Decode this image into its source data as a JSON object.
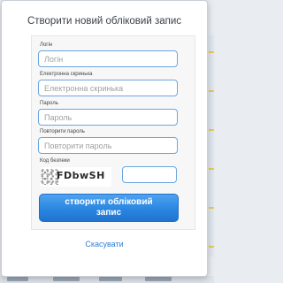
{
  "dialog": {
    "title": "Створити новий обліковий запис",
    "fields": {
      "login": {
        "label": "Логін",
        "placeholder": "Логін",
        "value": ""
      },
      "email": {
        "label": "Електронна скринька",
        "placeholder": "Електронна скринька",
        "value": ""
      },
      "password": {
        "label": "Пароль",
        "placeholder": "Пароль",
        "value": ""
      },
      "password_repeat": {
        "label": "Повторити пароль",
        "placeholder": "Повторити пароль",
        "value": ""
      },
      "captcha": {
        "label": "Код безпеки",
        "code": "FDbwSH",
        "value": ""
      }
    },
    "submit_label": "створити обліковий запис",
    "cancel_label": "Скасувати"
  },
  "colors": {
    "accent": "#2a86e0",
    "input_border": "#6aa6e0",
    "link": "#2f7fd3"
  },
  "icons": [
    "captcha-image"
  ]
}
